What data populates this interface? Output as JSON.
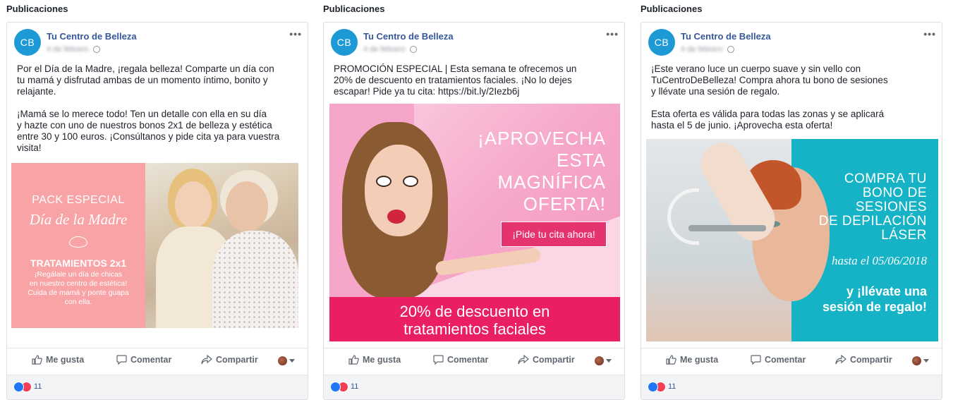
{
  "section_title": "Publicaciones",
  "page": {
    "name": "Tu Centro de Belleza",
    "avatar_initials": "CB",
    "meta": "4 de febrero"
  },
  "actions": {
    "like": "Me gusta",
    "comment": "Comentar",
    "share": "Compartir"
  },
  "colors": {
    "link": "#365899",
    "avatar": "#1d9ad6",
    "like": "#2078f4",
    "love": "#f33e58"
  },
  "posts": [
    {
      "text": "Por el Día de la Madre, ¡regala belleza! Comparte un día con\ntu mamá y disfrutad ambas de un momento íntimo, bonito y\nrelajante.\n\n¡Mamá se lo merece todo! Ten un detalle con ella en su día\ny hazte con uno de nuestros bonos 2x1 de belleza y estética\nentre 30 y 100 euros. ¡Consúltanos y pide cita ya para vuestra\nvisita!",
      "image": {
        "line1": "PACK ESPECIAL",
        "line2": "Día de la Madre",
        "line3": "TRATAMIENTOS 2x1",
        "line4": "¡Regálale un día de chicas\nen nuestro centro de estética!\nCuida de mamá y ponte guapa\ncon ella."
      },
      "reaction_count": "11"
    },
    {
      "text": "PROMOCIÓN ESPECIAL | Esta semana te ofrecemos un\n20% de descuento en tratamientos faciales. ¡No lo dejes\nescapar! Pide ya tu cita: https://bit.ly/2Iezb6j",
      "image": {
        "headline": "¡APROVECHA\nESTA\nMAGNÍFICA\nOFERTA!",
        "cta": "¡Pide tu cita ahora!",
        "banner": "20% de descuento en\ntratamientos faciales"
      },
      "reaction_count": "11"
    },
    {
      "text": "¡Este verano luce un cuerpo suave y sin vello con\nTuCentroDeBelleza! Compra ahora tu bono de sesiones\ny llévate una sesión de regalo.\n\nEsta oferta es válida para todas las zonas y se aplicará\nhasta el 5 de junio. ¡Aprovecha esta oferta!",
      "image": {
        "headline": "COMPRA TU\nBONO DE\nSESIONES\nDE DEPILACIÓN\nLÁSER",
        "until": "hasta el 05/06/2018",
        "gift": "y ¡llévate una\nsesión de regalo!"
      },
      "reaction_count": "11"
    }
  ]
}
